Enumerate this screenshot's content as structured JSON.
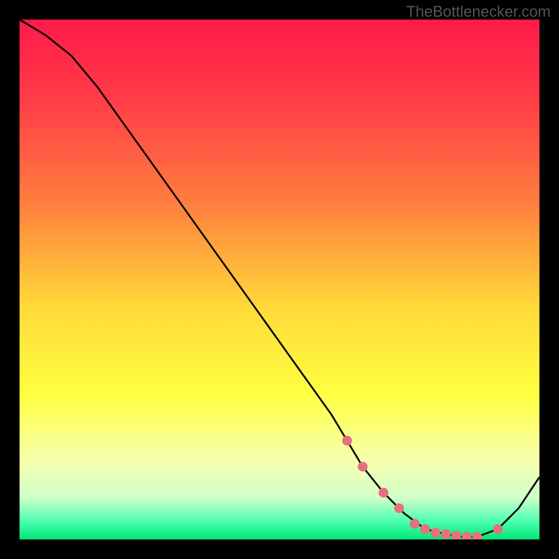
{
  "watermark": "TheBottlenecker.com",
  "chart_data": {
    "type": "line",
    "title": "",
    "xlabel": "",
    "ylabel": "",
    "xlim": [
      0,
      100
    ],
    "ylim": [
      0,
      100
    ],
    "series": [
      {
        "name": "curve",
        "x": [
          0,
          5,
          10,
          15,
          20,
          25,
          30,
          35,
          40,
          45,
          50,
          55,
          60,
          63,
          66,
          70,
          74,
          78,
          82,
          85,
          88,
          92,
          96,
          100
        ],
        "y": [
          100,
          97,
          93,
          87,
          80,
          73,
          66,
          59,
          52,
          45,
          38,
          31,
          24,
          19,
          14,
          9,
          5,
          2,
          1,
          0.5,
          0.5,
          2,
          6,
          12
        ]
      }
    ],
    "markers": {
      "name": "highlight-dots",
      "color": "#e76f7e",
      "x": [
        63,
        66,
        70,
        73,
        76,
        78,
        80,
        82,
        84,
        86,
        88,
        92
      ],
      "y": [
        19,
        14,
        9,
        6,
        3,
        2,
        1.3,
        1,
        0.7,
        0.5,
        0.5,
        2
      ]
    },
    "gradient_stops": [
      {
        "offset": 0.0,
        "color": "#ff1a4a"
      },
      {
        "offset": 0.15,
        "color": "#ff3b48"
      },
      {
        "offset": 0.35,
        "color": "#ff7d3e"
      },
      {
        "offset": 0.55,
        "color": "#ffd83a"
      },
      {
        "offset": 0.72,
        "color": "#ffff40"
      },
      {
        "offset": 0.85,
        "color": "#f6ffb0"
      },
      {
        "offset": 0.92,
        "color": "#d0ffc8"
      },
      {
        "offset": 0.965,
        "color": "#4dffb0"
      },
      {
        "offset": 1.0,
        "color": "#00e676"
      }
    ]
  }
}
